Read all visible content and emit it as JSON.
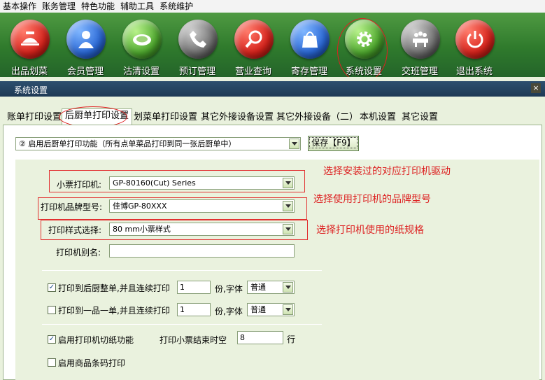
{
  "menu": [
    "基本操作",
    "账务管理",
    "特色功能",
    "辅助工具",
    "系统维护"
  ],
  "toolbar": [
    {
      "label": "出品划菜",
      "icon": "cloche-icon",
      "color": "red"
    },
    {
      "label": "会员管理",
      "icon": "user-icon",
      "color": "blue"
    },
    {
      "label": "沽清设置",
      "icon": "plate-icon",
      "color": "green"
    },
    {
      "label": "预订管理",
      "icon": "phone-icon",
      "color": "gray"
    },
    {
      "label": "营业查询",
      "icon": "magnifier-icon",
      "color": "red"
    },
    {
      "label": "寄存管理",
      "icon": "bag-icon",
      "color": "blue"
    },
    {
      "label": "系统设置",
      "icon": "gear-icon",
      "color": "green"
    },
    {
      "label": "交班管理",
      "icon": "meeting-icon",
      "color": "gray"
    },
    {
      "label": "退出系统",
      "icon": "power-icon",
      "color": "red"
    }
  ],
  "dialog": {
    "title": "系统设置",
    "close": "×",
    "tabs": [
      "账单打印设置",
      "后厨单打印设置",
      "划菜单打印设置",
      "其它外接设备设置",
      "其它外接设备（二）",
      "本机设置",
      "其它设置"
    ],
    "active_tab": 1,
    "mode_select": "② 启用后厨单打印功能（所有点单菜品打印到同一张后厨单中）",
    "save_button": "保存【F9】",
    "printer_label": "小票打印机:",
    "printer_value": "GP-80160(Cut) Series",
    "brand_label": "打印机品牌型号:",
    "brand_value": "佳博GP-80XXX",
    "style_label": "打印样式选择:",
    "style_value": "80  mm小票样式",
    "alias_label": "打印机别名:",
    "alias_value": "",
    "note_driver": "选择安装过的对应打印机驱动",
    "note_brand": "选择使用打印机的品牌型号",
    "note_paper": "选择打印机使用的纸规格",
    "opt1_label": "打印到后厨整单,并且连续打印",
    "opt1_checked": true,
    "opt1_copies": "1",
    "opt2_label": "打印到一品一单,并且连续打印",
    "opt2_checked": false,
    "opt2_copies": "1",
    "copies_font_label": "份,字体",
    "font_value": "普通",
    "cut_label": "启用打印机切纸功能",
    "cut_checked": true,
    "blank_label": "打印小票结束时空",
    "blank_value": "8",
    "blank_unit": "行",
    "barcode_label": "启用商品条码打印",
    "barcode_checked": false
  },
  "colors": {
    "annotation_red": "#d22222",
    "toolbar_green": "#2f7a2c",
    "dialog_bg": "#e9f1dd"
  }
}
